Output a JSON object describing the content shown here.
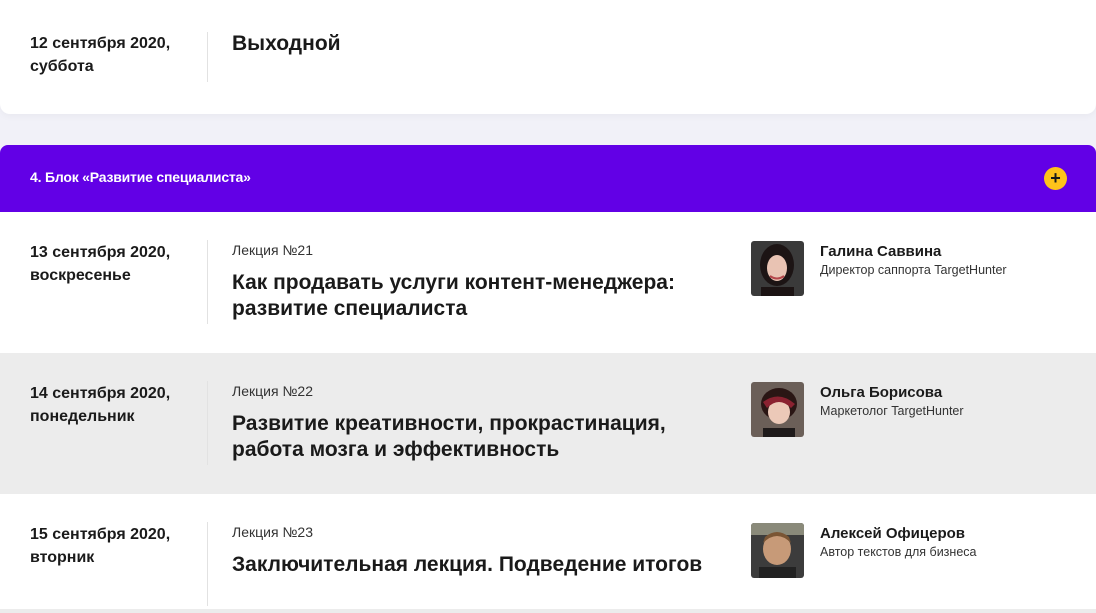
{
  "dayoff": {
    "date": "12 сентября 2020, суббота",
    "title": "Выходной"
  },
  "block": {
    "title": "4. Блок «Развитие специалиста»",
    "toggle_icon": "plus-icon",
    "accent_color": "#6200e6",
    "toggle_color": "#ffc21a"
  },
  "lectures": [
    {
      "date": "13 сентября 2020, воскресенье",
      "number": "Лекция №21",
      "title": "Как продавать услуги контент-менеджера: развитие специалиста",
      "speaker_name": "Галина Саввина",
      "speaker_role": "Директор саппорта TargetHunter"
    },
    {
      "date": "14 сентября 2020, понедельник",
      "number": "Лекция №22",
      "title": "Развитие креативности, прокрастинация, работа мозга и эффективность",
      "speaker_name": "Ольга Борисова",
      "speaker_role": "Маркетолог TargetHunter"
    },
    {
      "date": "15 сентября 2020, вторник",
      "number": "Лекция №23",
      "title": "Заключительная лекция. Подведение итогов",
      "speaker_name": "Алексей Офицеров",
      "speaker_role": "Автор текстов для бизнеса"
    }
  ]
}
